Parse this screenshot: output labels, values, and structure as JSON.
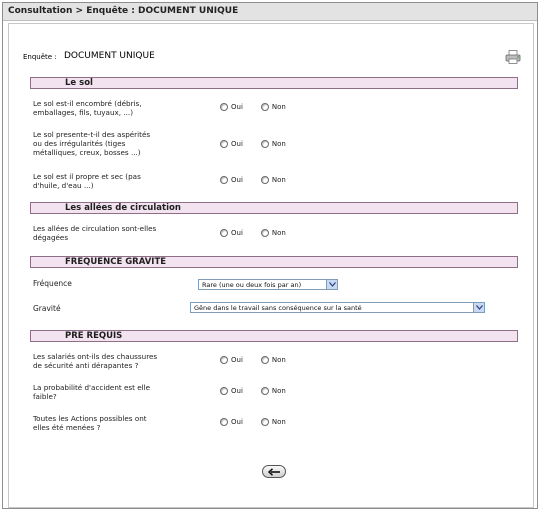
{
  "window": {
    "breadcrumb": "Consultation > Enquête : DOCUMENT UNIQUE"
  },
  "header": {
    "label": "Enquête :",
    "value": "DOCUMENT UNIQUE"
  },
  "radio_labels": {
    "yes": "Oui",
    "no": "Non"
  },
  "sections": {
    "sol": {
      "title": "Le sol",
      "questions": [
        [
          "Le sol est-il encombré (débris,",
          "emballages, fils, tuyaux, ...)"
        ],
        [
          "Le sol presente-t-il des aspérités",
          "ou des irrégularités (tiges",
          "métalliques, creux, bosses ...)"
        ],
        [
          "Le sol est il propre et sec (pas",
          "d'huile, d'eau ...)"
        ]
      ]
    },
    "allees": {
      "title": "Les allées de circulation",
      "questions": [
        [
          "Les allées de circulation sont-elles",
          "dégagées"
        ]
      ]
    },
    "frequence": {
      "title": "FREQUENCE GRAVITE",
      "frequence_label": "Fréquence",
      "frequence_value": "Rare (une ou deux fois par an)",
      "gravite_label": "Gravité",
      "gravite_value": "Gêne dans le travail sans conséquence sur la santé"
    },
    "prerequis": {
      "title": "PRE REQUIS",
      "questions": [
        [
          "Les salariés ont-ils des chaussures",
          "de sécurité anti dérapantes ?"
        ],
        [
          "La probabilité d'accident est elle",
          "faible?"
        ],
        [
          "Toutes les Actions possibles ont",
          "elles été menées ?"
        ]
      ]
    }
  }
}
